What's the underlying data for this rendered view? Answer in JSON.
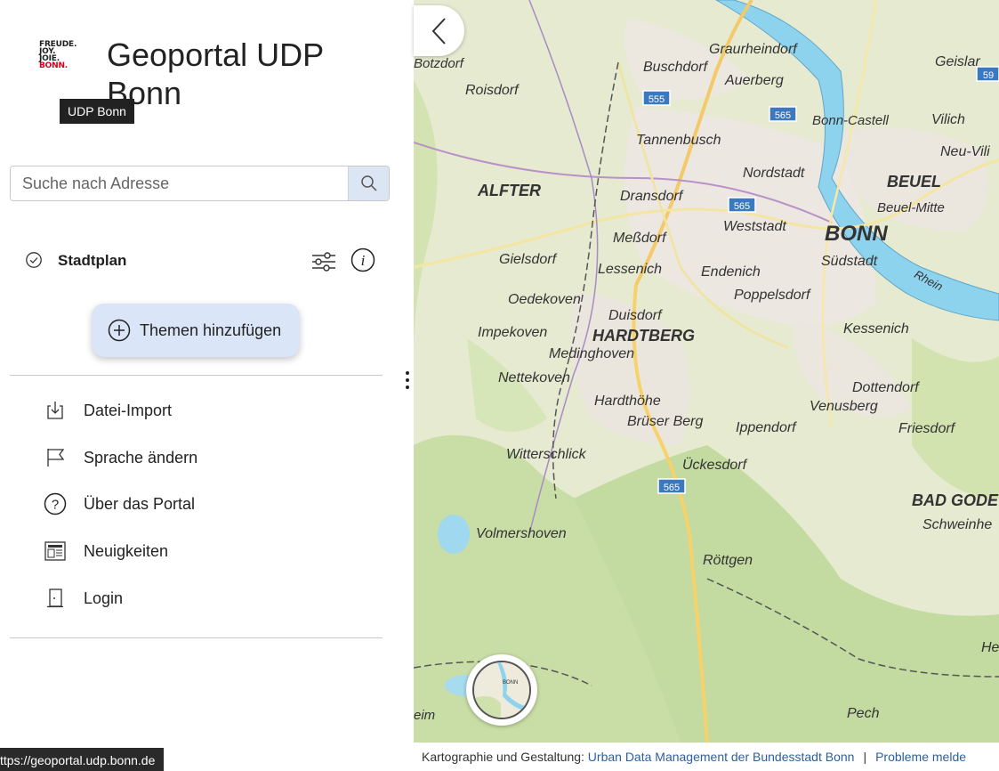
{
  "header": {
    "logo_lines": [
      "FREUDE.",
      "JOY.",
      "JOIE.",
      "BONN."
    ],
    "title": "Geoportal UDP Bonn",
    "tooltip": "UDP Bonn"
  },
  "search": {
    "placeholder": "Suche nach Adresse",
    "button_icon": "search-icon"
  },
  "layers": [
    {
      "name": "Stadtplan",
      "status_icon": "check-circle-icon",
      "settings_icon": "sliders-icon",
      "info_icon": "info-icon"
    }
  ],
  "add_topics_button": {
    "label": "Themen hinzufügen",
    "icon": "plus-circle-icon"
  },
  "menu": {
    "items": [
      {
        "label": "Datei-Import",
        "icon": "import-icon"
      },
      {
        "label": "Sprache ändern",
        "icon": "flag-icon"
      },
      {
        "label": "Über das Portal",
        "icon": "help-circle-icon"
      },
      {
        "label": "Neuigkeiten",
        "icon": "news-icon"
      },
      {
        "label": "Login",
        "icon": "door-icon"
      }
    ]
  },
  "status_url": "ttps://geoportal.udp.bonn.de",
  "map": {
    "place_labels": [
      "Graurheindorf",
      "Buschdorf",
      "Auerberg",
      "Roisdorf",
      "Geislar",
      "Tannenbusch",
      "Bonn-Castell",
      "Vilich",
      "Nordstadt",
      "Neu-Vili",
      "BEUEL",
      "ALFTER",
      "Dransdorf",
      "Beuel-Mitte",
      "Weststadt",
      "BONN",
      "Meßdorf",
      "Südstadt",
      "Gielsdorf",
      "Lessenich",
      "Endenich",
      "Poppelsdorf",
      "Oedekoven",
      "Duisdorf",
      "Impekoven",
      "HARDTBERG",
      "Kessenich",
      "Medinghoven",
      "Nettekoven",
      "Dottendorf",
      "Hardthöhe",
      "Venusberg",
      "Brüser Berg",
      "Ippendorf",
      "Friesdorf",
      "Witterschlick",
      "Ückesdorf",
      "BAD GODE",
      "Schweinhe",
      "Volmershoven",
      "Röttgen",
      "He",
      "Pech",
      "Rhein",
      "Botzdorf",
      "eim"
    ],
    "road_shields": [
      "555",
      "565",
      "565",
      "565",
      "59"
    ],
    "collapse_icon": "chevron-left-icon",
    "overview_label": "BONN"
  },
  "attribution": {
    "prefix": "Kartographie und Gestaltung: ",
    "link": "Urban Data Management der Bundesstadt Bonn",
    "separator": "|",
    "report": "Probleme melde"
  }
}
